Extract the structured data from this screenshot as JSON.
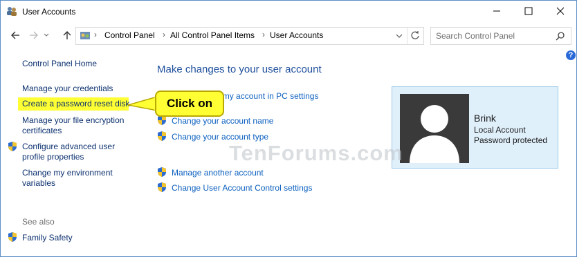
{
  "window": {
    "title": "User Accounts"
  },
  "address": {
    "breadcrumbs": [
      "Control Panel",
      "All Control Panel Items",
      "User Accounts"
    ],
    "search_placeholder": "Search Control Panel"
  },
  "sidebar": {
    "home": "Control Panel Home",
    "items": [
      "Manage your credentials",
      "Create a password reset disk",
      "Manage your file encryption",
      "certificates",
      "Configure advanced user",
      "profile properties",
      "Change my environment",
      "variables"
    ],
    "see_also": "See also",
    "family_safety": "Family Safety"
  },
  "main": {
    "heading": "Make changes to your user account",
    "links": [
      "Make changes to my account in PC settings",
      "Change your account name",
      "Change your account type",
      "Manage another account",
      "Change User Account Control settings"
    ]
  },
  "user": {
    "name": "Brink",
    "account_type": "Local Account",
    "password_status": "Password protected"
  },
  "callout": {
    "text": "Click on"
  },
  "watermark": "TenForums.com",
  "colors": {
    "highlight": "#ffff33",
    "link": "#0b5fbf",
    "heading": "#1e4f9d",
    "panel": "#e0f0fb"
  }
}
